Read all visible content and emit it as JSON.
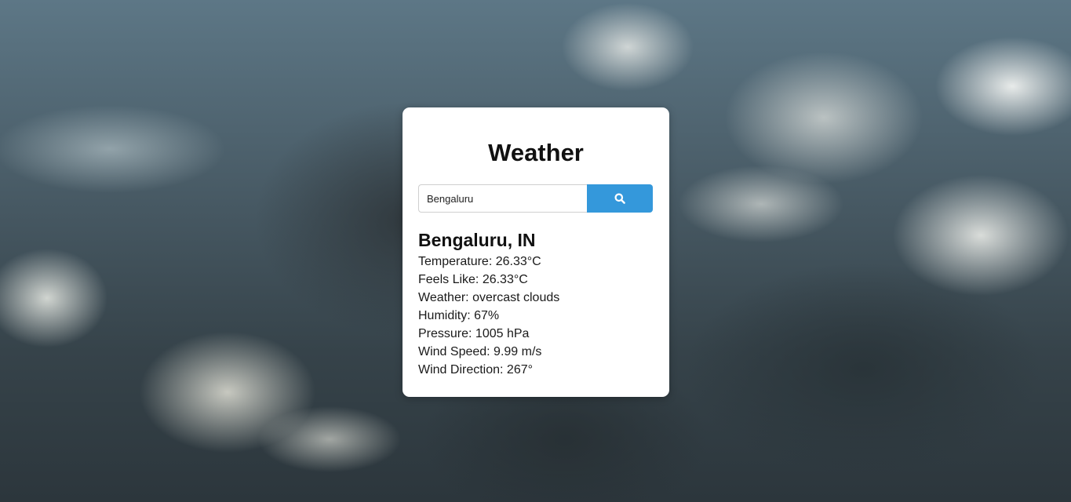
{
  "app": {
    "title": "Weather"
  },
  "search": {
    "value": "Bengaluru",
    "button_icon": "search-icon"
  },
  "result": {
    "location": "Bengaluru, IN",
    "rows": [
      {
        "label": "Temperature",
        "text": "Temperature: 26.33°C"
      },
      {
        "label": "Feels Like",
        "text": "Feels Like: 26.33°C"
      },
      {
        "label": "Weather",
        "text": "Weather: overcast clouds"
      },
      {
        "label": "Humidity",
        "text": "Humidity: 67%"
      },
      {
        "label": "Pressure",
        "text": "Pressure: 1005 hPa"
      },
      {
        "label": "Wind Speed",
        "text": "Wind Speed: 9.99 m/s"
      },
      {
        "label": "Wind Direction",
        "text": "Wind Direction: 267°"
      }
    ]
  },
  "colors": {
    "accent": "#3498db",
    "card": "#ffffff"
  }
}
